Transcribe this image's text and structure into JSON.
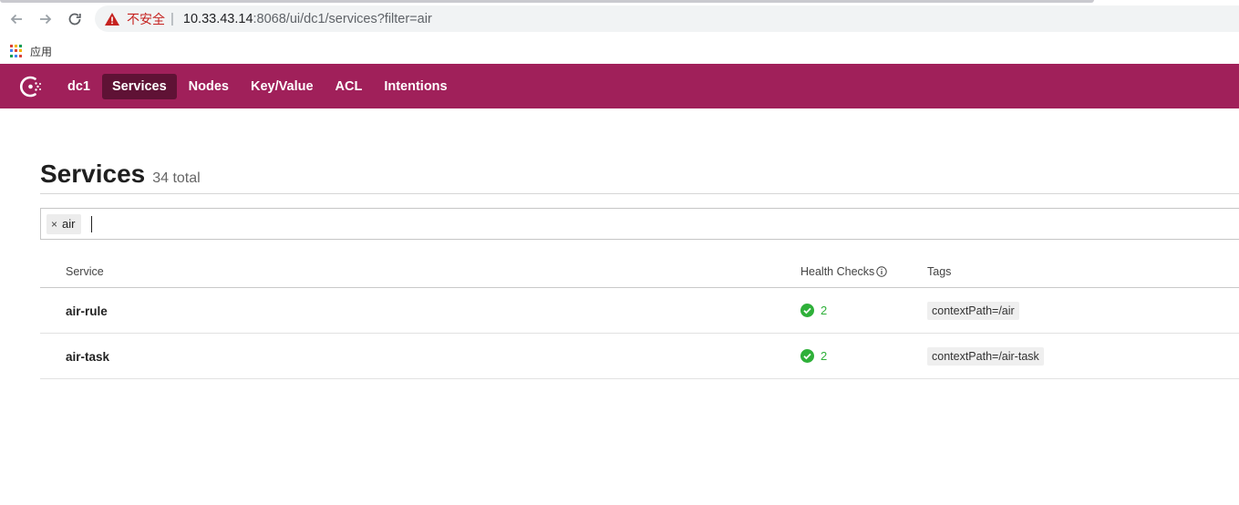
{
  "browser": {
    "insecure_label": "不安全",
    "url_host": "10.33.43.14",
    "url_rest": ":8068/ui/dc1/services?filter=air",
    "bookmark_apps": "应用"
  },
  "nav": {
    "datacenter": "dc1",
    "items": [
      {
        "label": "Services",
        "active": true
      },
      {
        "label": "Nodes",
        "active": false
      },
      {
        "label": "Key/Value",
        "active": false
      },
      {
        "label": "ACL",
        "active": false
      },
      {
        "label": "Intentions",
        "active": false
      }
    ],
    "accent": "#a0205a",
    "active_bg": "#5f1235"
  },
  "page": {
    "title": "Services",
    "count": "34 total"
  },
  "filter": {
    "chip_label": "air",
    "chip_remove": "×"
  },
  "table": {
    "columns": {
      "service": "Service",
      "health": "Health Checks",
      "tags": "Tags"
    },
    "rows": [
      {
        "service": "air-rule",
        "health_passing": "2",
        "tag": "contextPath=/air"
      },
      {
        "service": "air-task",
        "health_passing": "2",
        "tag": "contextPath=/air-task"
      }
    ]
  }
}
